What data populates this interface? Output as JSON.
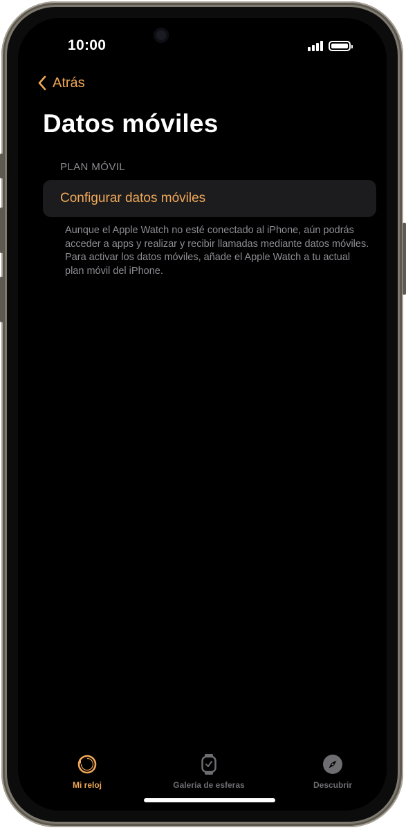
{
  "status_bar": {
    "time": "10:00"
  },
  "nav": {
    "back_label": "Atrás"
  },
  "page": {
    "title": "Datos móviles"
  },
  "section": {
    "header": "PLAN MÓVIL",
    "row_label": "Configurar datos móviles",
    "footer": "Aunque el Apple Watch no esté conectado al iPhone, aún podrás acceder a apps y realizar y recibir llamadas mediante datos móviles. Para activar los datos móviles, añade el Apple Watch a tu actual plan móvil del iPhone."
  },
  "tabbar": {
    "items": [
      {
        "label": "Mi reloj",
        "icon": "watch-face-icon",
        "active": true
      },
      {
        "label": "Galería de esferas",
        "icon": "watch-icon",
        "active": false
      },
      {
        "label": "Descubrir",
        "icon": "compass-icon",
        "active": false
      }
    ]
  },
  "colors": {
    "accent": "#f0a858",
    "background": "#000000",
    "cell": "#1c1c1e",
    "secondary_text": "#8d8d93",
    "inactive_tab": "#6d6d72"
  }
}
